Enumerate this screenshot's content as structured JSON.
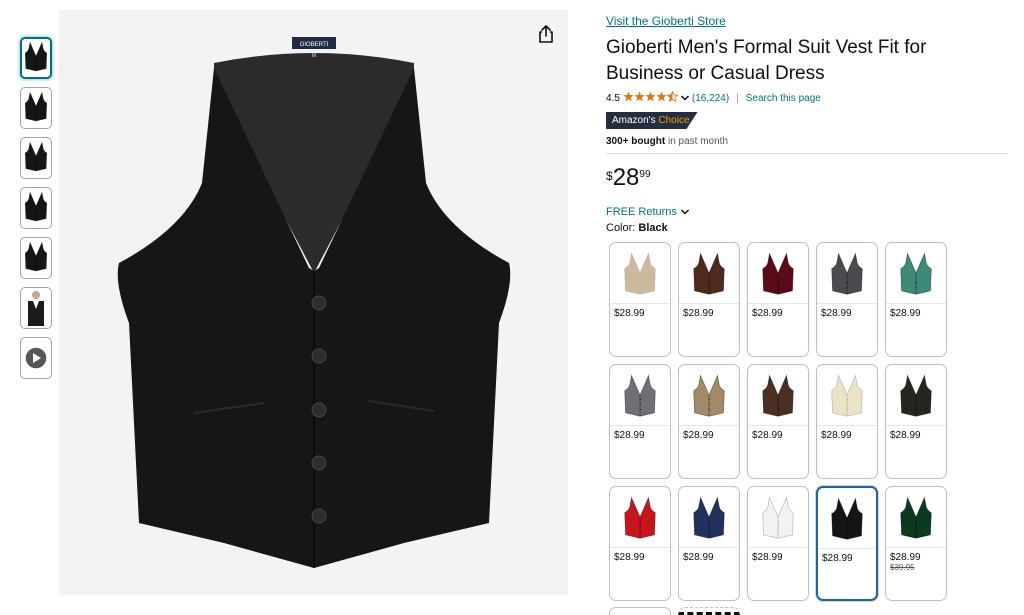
{
  "store_link": "Visit the Gioberti Store",
  "title": "Gioberti Men's Formal Suit Vest Fit for Business or Casual Dress",
  "rating": {
    "value": "4.5",
    "stars": 4.5,
    "count": "(16,224)",
    "search": "Search this page"
  },
  "badge": {
    "part1": "Amazon's",
    "part2": "Choice"
  },
  "bought": {
    "strong": "300+ bought",
    "rest": " in past month"
  },
  "price": {
    "symbol": "$",
    "whole": "28",
    "fraction": "99"
  },
  "returns": "FREE Returns",
  "color": {
    "label": "Color: ",
    "selected": "Black"
  },
  "label_tag": "GIOBERTI",
  "label_size": "M",
  "thumbnails": [
    {
      "name": "thumb-black-vest-front",
      "selected": true
    },
    {
      "name": "thumb-vest-with-shirt-tie",
      "selected": false
    },
    {
      "name": "thumb-black-vest-back",
      "selected": false
    },
    {
      "name": "thumb-vest-detail",
      "selected": false
    },
    {
      "name": "thumb-vest-lining",
      "selected": false
    },
    {
      "name": "thumb-model-wearing-vest",
      "selected": false
    },
    {
      "name": "thumb-video",
      "selected": false,
      "video": true
    }
  ],
  "swatches": [
    {
      "color": "#cdb99a",
      "price": "$28.99"
    },
    {
      "color": "#4e2a1c",
      "price": "$28.99"
    },
    {
      "color": "#5b0a17",
      "price": "$28.99"
    },
    {
      "color": "#4b4b4f",
      "price": "$28.99"
    },
    {
      "color": "#3e8a78",
      "price": "$28.99"
    },
    {
      "color": "#6e7076",
      "price": "$28.99"
    },
    {
      "color": "#a38a66",
      "price": "$28.99"
    },
    {
      "color": "#4b3021",
      "price": "$28.99"
    },
    {
      "color": "#ece3c4",
      "price": "$28.99"
    },
    {
      "color": "#23271f",
      "price": "$28.99"
    },
    {
      "color": "#c8151b",
      "price": "$28.99"
    },
    {
      "color": "#22305e",
      "price": "$28.99"
    },
    {
      "color": "#f2f2f2",
      "price": "$28.99"
    },
    {
      "color": "#151515",
      "price": "$28.99",
      "selected": true
    },
    {
      "color": "#0c3a1e",
      "price": "$28.99",
      "old_price": "$39.95"
    }
  ],
  "colors": {
    "link": "#007185",
    "star": "#de7921",
    "badge_bg": "#232f3e",
    "badge_accent": "#ff9900",
    "selected_border": "#2162a1"
  }
}
